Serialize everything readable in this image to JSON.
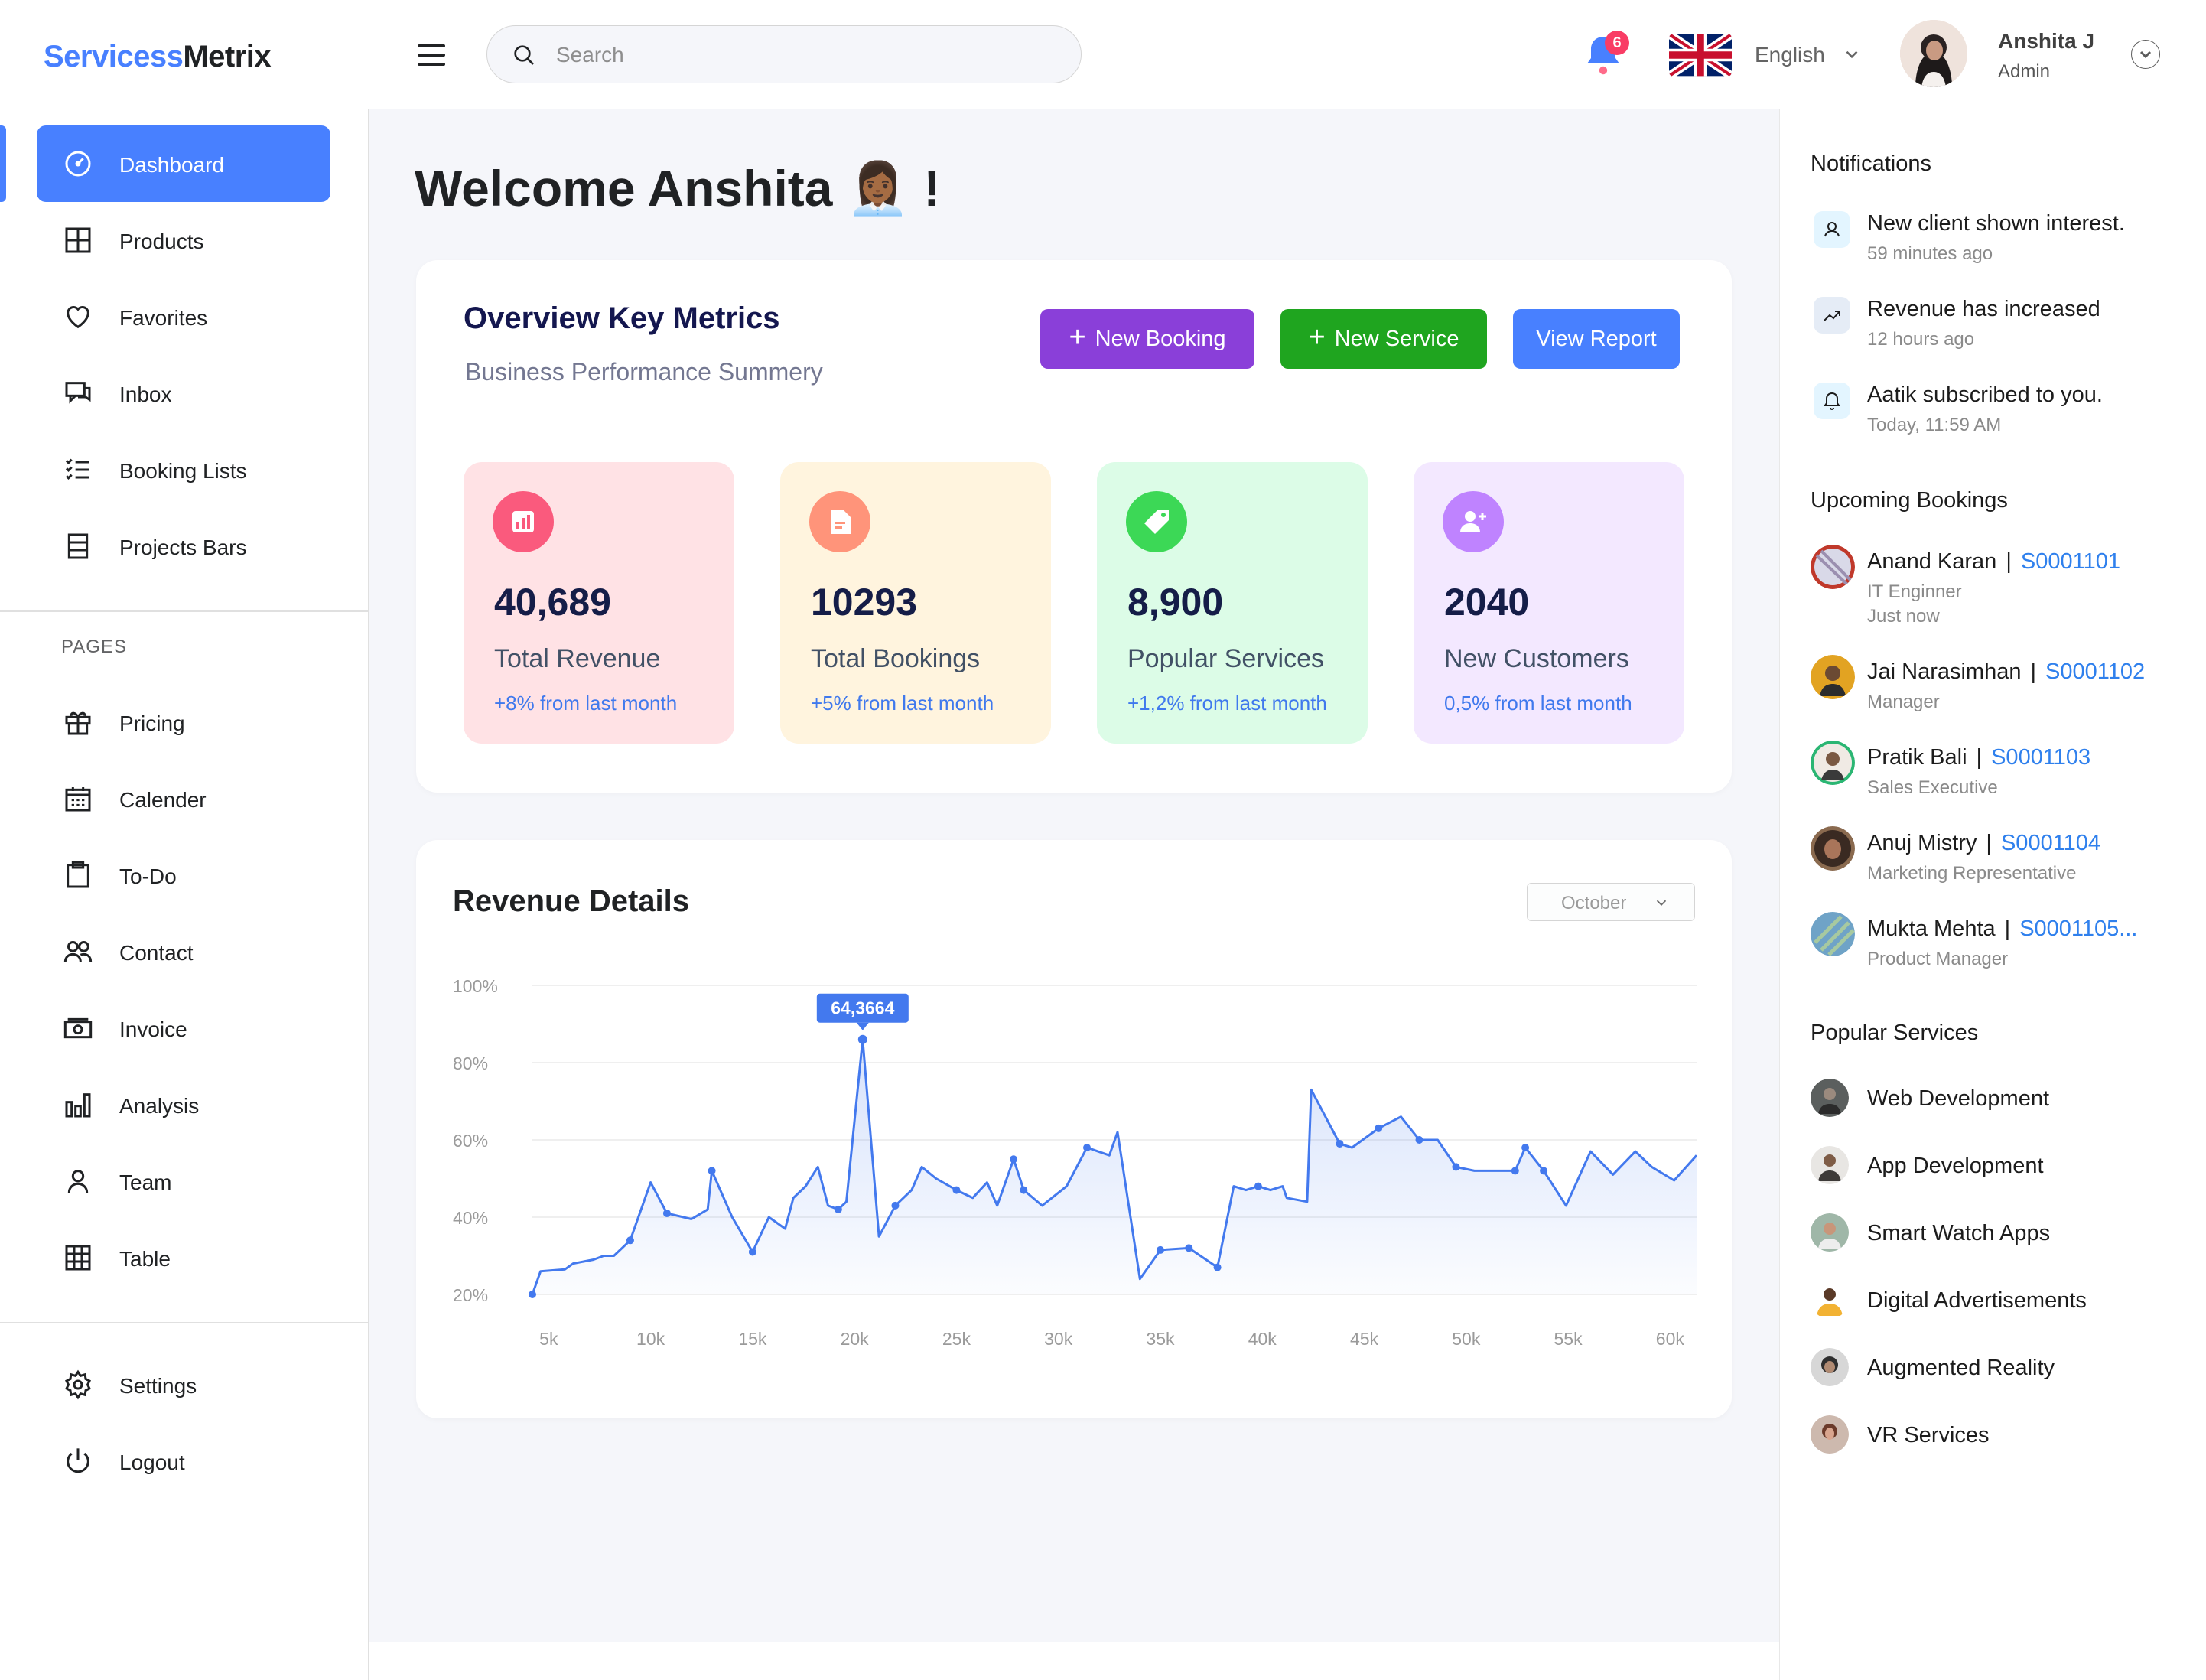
{
  "brand": {
    "part1": "Servicess",
    "part2": "Metrix"
  },
  "header": {
    "search_placeholder": "Search",
    "notification_count": "6",
    "language": "English",
    "user_name": "Anshita J",
    "user_role": "Admin"
  },
  "sidebar": {
    "main_items": [
      {
        "label": "Dashboard",
        "icon": "dashboard-gauge-icon",
        "active": true
      },
      {
        "label": "Products",
        "icon": "grid-icon"
      },
      {
        "label": "Favorites",
        "icon": "heart-icon"
      },
      {
        "label": "Inbox",
        "icon": "chat-icon"
      },
      {
        "label": "Booking Lists",
        "icon": "checklist-icon"
      },
      {
        "label": "Projects Bars",
        "icon": "stack-icon"
      }
    ],
    "pages_heading": "PAGES",
    "page_items": [
      {
        "label": "Pricing",
        "icon": "gift-icon"
      },
      {
        "label": "Calender",
        "icon": "calendar-icon"
      },
      {
        "label": "To-Do",
        "icon": "clipboard-icon"
      },
      {
        "label": "Contact",
        "icon": "users-icon"
      },
      {
        "label": "Invoice",
        "icon": "cash-icon"
      },
      {
        "label": "Analysis",
        "icon": "bar-chart-icon"
      },
      {
        "label": "Team",
        "icon": "person-icon"
      },
      {
        "label": "Table",
        "icon": "table-icon"
      }
    ],
    "bottom_items": [
      {
        "label": "Settings",
        "icon": "gear-icon"
      },
      {
        "label": "Logout",
        "icon": "power-icon"
      }
    ]
  },
  "main": {
    "welcome": "Welcome Anshita 👩🏾‍💼 !",
    "overview": {
      "title": "Overview Key Metrics",
      "subtitle": "Business Performance Summery",
      "buttons": {
        "new_booking": "New Booking",
        "new_service": "New Service",
        "view_report": "View Report"
      },
      "metrics": [
        {
          "value": "40,689",
          "label": "Total Revenue",
          "change": "+8% from last month",
          "bg": "#FFE2E5",
          "icon_bg": "#FA5A7D"
        },
        {
          "value": "10293",
          "label": "Total Bookings",
          "change": "+5% from last month",
          "bg": "#FFF4DE",
          "icon_bg": "#FF947A"
        },
        {
          "value": "8,900",
          "label": "Popular Services",
          "change": "+1,2% from last month",
          "bg": "#DCFCE7",
          "icon_bg": "#3CD856"
        },
        {
          "value": "2040",
          "label": "New Customers",
          "change": "0,5% from last month",
          "bg": "#F3E8FF",
          "icon_bg": "#BF83FF"
        }
      ]
    },
    "revenue": {
      "title": "Revenue Details",
      "month": "October"
    }
  },
  "chart_data": {
    "type": "area",
    "title": "Revenue Details",
    "x_tick_labels": [
      "5k",
      "10k",
      "15k",
      "20k",
      "25k",
      "30k",
      "35k",
      "40k",
      "45k",
      "50k",
      "55k",
      "60k"
    ],
    "y_tick_labels": [
      "100%",
      "80%",
      "60%",
      "40%",
      "20%"
    ],
    "ylim": [
      20,
      100
    ],
    "xlim": [
      4200,
      61300
    ],
    "grid": true,
    "highlight": {
      "x": 20400,
      "y": 86,
      "label": "64,3664"
    },
    "series": [
      {
        "values": [
          [
            4200,
            20
          ],
          [
            4600,
            26
          ],
          [
            5800,
            26.5
          ],
          [
            6200,
            28
          ],
          [
            7200,
            29
          ],
          [
            7700,
            30
          ],
          [
            8200,
            30
          ],
          [
            9000,
            34
          ],
          [
            10000,
            49
          ],
          [
            10800,
            41
          ],
          [
            12000,
            39.5
          ],
          [
            12800,
            42
          ],
          [
            13000,
            52
          ],
          [
            14000,
            40
          ],
          [
            15000,
            31
          ],
          [
            15800,
            40
          ],
          [
            16600,
            37
          ],
          [
            17000,
            45
          ],
          [
            17600,
            48
          ],
          [
            18200,
            53
          ],
          [
            18700,
            43
          ],
          [
            19200,
            42
          ],
          [
            19600,
            44
          ],
          [
            20400,
            86
          ],
          [
            21200,
            35
          ],
          [
            22000,
            43
          ],
          [
            22800,
            47
          ],
          [
            23300,
            53
          ],
          [
            24000,
            50
          ],
          [
            25000,
            47
          ],
          [
            25800,
            45
          ],
          [
            26500,
            49
          ],
          [
            27000,
            43
          ],
          [
            27800,
            55
          ],
          [
            28300,
            47
          ],
          [
            29200,
            43
          ],
          [
            30400,
            48
          ],
          [
            31400,
            58
          ],
          [
            32500,
            56
          ],
          [
            32900,
            62
          ],
          [
            34000,
            24
          ],
          [
            35000,
            31.5
          ],
          [
            36400,
            32
          ],
          [
            37800,
            27
          ],
          [
            38600,
            48
          ],
          [
            39200,
            47
          ],
          [
            39800,
            48
          ],
          [
            40400,
            47
          ],
          [
            41000,
            48
          ],
          [
            41200,
            45
          ],
          [
            42200,
            44
          ],
          [
            42400,
            73
          ],
          [
            43800,
            59
          ],
          [
            44400,
            58
          ],
          [
            45700,
            63
          ],
          [
            46800,
            66
          ],
          [
            47700,
            60
          ],
          [
            48600,
            60
          ],
          [
            49500,
            53
          ],
          [
            50400,
            52
          ],
          [
            51300,
            52
          ],
          [
            52400,
            52
          ],
          [
            52900,
            58
          ],
          [
            53800,
            52
          ],
          [
            54900,
            43
          ],
          [
            56100,
            57
          ],
          [
            57200,
            51
          ],
          [
            58300,
            57
          ],
          [
            59100,
            53
          ],
          [
            60200,
            49.5
          ],
          [
            61300,
            56
          ]
        ]
      }
    ]
  },
  "right_panel": {
    "notifications_title": "Notifications",
    "notifications": [
      {
        "text": "New client shown interest.",
        "time": "59 minutes ago",
        "icon": "user-icon"
      },
      {
        "text": "Revenue has increased",
        "time": "12 hours ago",
        "icon": "trend-up-icon"
      },
      {
        "text": "Aatik subscribed to you.",
        "time": "Today, 11:59 AM",
        "icon": "bell-icon"
      }
    ],
    "bookings_title": "Upcoming Bookings",
    "bookings": [
      {
        "name": "Anand Karan",
        "id": "S0001101",
        "role": " IT Enginner",
        "extra": "Just now",
        "color": "#C0392B"
      },
      {
        "name": "Jai Narasimhan",
        "id": "S0001102",
        "role": "Manager",
        "extra": "",
        "color": "#E2A322"
      },
      {
        "name": "Pratik Bali",
        "id": "S0001103",
        "role": "Sales Executive",
        "extra": "",
        "color": "#2BB673"
      },
      {
        "name": "Anuj Mistry",
        "id": "S0001104",
        "role": "Marketing Representative",
        "extra": "",
        "color": "#8A6A4F"
      },
      {
        "name": "Mukta Mehta",
        "id": "S0001105...",
        "role": "Product Manager",
        "extra": "",
        "color": "#6FA3C7"
      }
    ],
    "services_title": "Popular Services",
    "services": [
      {
        "name": "Web Development",
        "color": "#5B5F5E"
      },
      {
        "name": "App Development",
        "color": "#3D3A38"
      },
      {
        "name": "Smart Watch Apps",
        "color": "#9FB7A8"
      },
      {
        "name": "Digital Advertisements",
        "color": "#F2B233"
      },
      {
        "name": "Augmented Reality",
        "color": "#2E2E2E"
      },
      {
        "name": "VR Services",
        "color": "#B57B6A"
      }
    ]
  }
}
